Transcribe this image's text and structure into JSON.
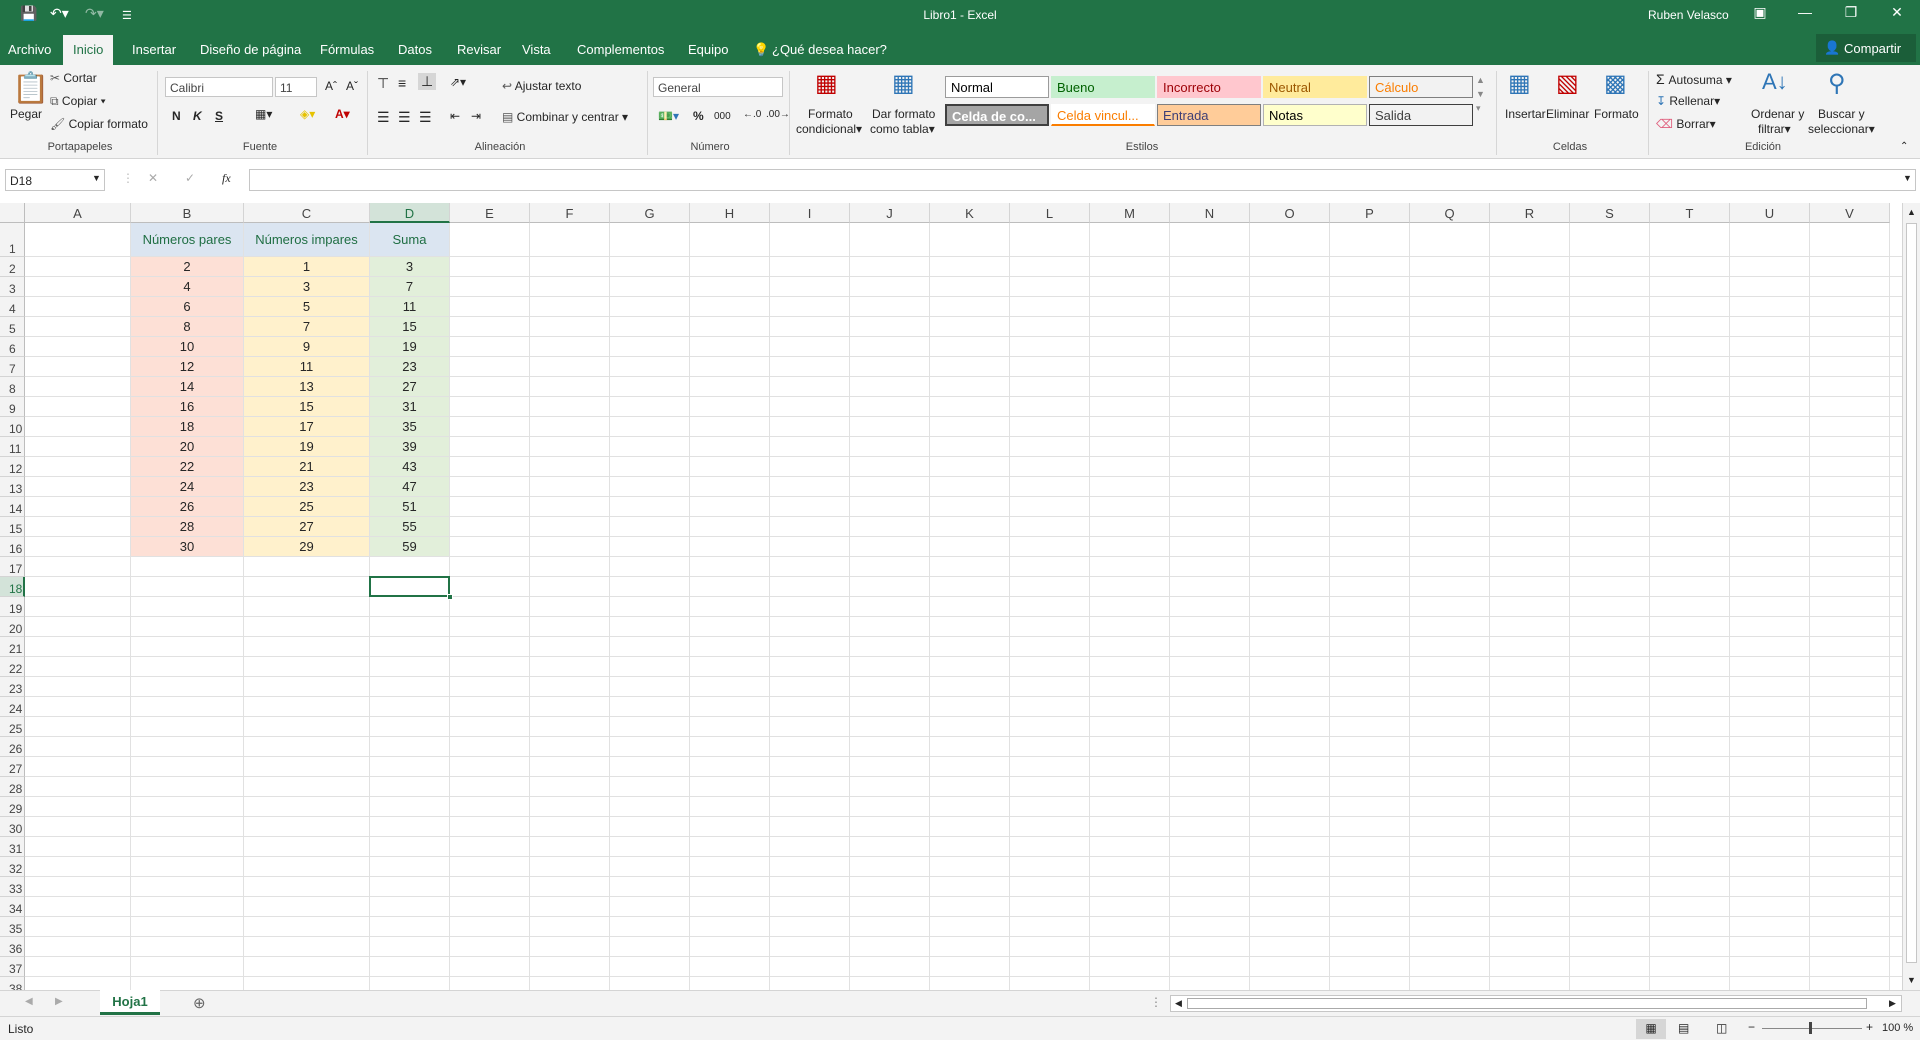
{
  "window": {
    "title": "Libro1  -  Excel",
    "user": "Ruben Velasco"
  },
  "tabs": [
    "Archivo",
    "Inicio",
    "Insertar",
    "Diseño de página",
    "Fórmulas",
    "Datos",
    "Revisar",
    "Vista",
    "Complementos",
    "Equipo"
  ],
  "tell_me": "¿Qué desea hacer?",
  "share": "Compartir",
  "ribbon": {
    "clipboard": {
      "paste": "Pegar",
      "cut": "Cortar",
      "copy": "Copiar",
      "format_painter": "Copiar formato",
      "group": "Portapapeles"
    },
    "font": {
      "name": "Calibri",
      "size": "11",
      "bold": "N",
      "italic": "K",
      "underline": "S",
      "group": "Fuente"
    },
    "alignment": {
      "wrap": "Ajustar texto",
      "merge": "Combinar y centrar",
      "group": "Alineación"
    },
    "number": {
      "format": "General",
      "percent": "%",
      "thousands": "000",
      "group": "Número"
    },
    "styles": {
      "conditional_1": "Formato",
      "conditional_2": "condicional",
      "table_1": "Dar formato",
      "table_2": "como tabla",
      "cells": [
        {
          "label": "Normal",
          "bg": "#ffffff",
          "fg": "#000000",
          "border": "#9b9b9b"
        },
        {
          "label": "Bueno",
          "bg": "#c6efce",
          "fg": "#006100",
          "border": "#c6efce"
        },
        {
          "label": "Incorrecto",
          "bg": "#ffc7ce",
          "fg": "#9c0006",
          "border": "#ffc7ce"
        },
        {
          "label": "Neutral",
          "bg": "#ffeb9c",
          "fg": "#9c5700",
          "border": "#ffeb9c"
        },
        {
          "label": "Cálculo",
          "bg": "#f2f2f2",
          "fg": "#fa7d00",
          "border": "#7f7f7f"
        },
        {
          "label": "Celda de co...",
          "bg": "#a5a5a5",
          "fg": "#ffffff",
          "border": "#3f3f3f"
        },
        {
          "label": "Celda vincul...",
          "bg": "#ffffff",
          "fg": "#fa7d00",
          "border": "#ffffff"
        },
        {
          "label": "Entrada",
          "bg": "#ffcc99",
          "fg": "#3f3f76",
          "border": "#7f7f7f"
        },
        {
          "label": "Notas",
          "bg": "#ffffcc",
          "fg": "#000000",
          "border": "#b2b2b2"
        },
        {
          "label": "Salida",
          "bg": "#f2f2f2",
          "fg": "#3f3f3f",
          "border": "#3f3f3f"
        }
      ],
      "group": "Estilos"
    },
    "cells": {
      "insert": "Insertar",
      "delete": "Eliminar",
      "format": "Formato",
      "group": "Celdas"
    },
    "editing": {
      "autosum": "Autosuma",
      "fill": "Rellenar",
      "clear": "Borrar",
      "sort_1": "Ordenar y",
      "sort_2": "filtrar",
      "find_1": "Buscar y",
      "find_2": "seleccionar",
      "group": "Edición"
    }
  },
  "formula_bar": {
    "name_box": "D18",
    "fx": "fx",
    "value": ""
  },
  "columns": [
    "A",
    "B",
    "C",
    "D",
    "E",
    "F",
    "G",
    "H",
    "I",
    "J",
    "K",
    "L",
    "M",
    "N",
    "O",
    "P",
    "Q",
    "R",
    "S",
    "T",
    "U",
    "V"
  ],
  "rows": [
    "1",
    "2",
    "3",
    "4",
    "5",
    "6",
    "7",
    "8",
    "9",
    "10",
    "11",
    "12",
    "13",
    "14",
    "15",
    "16",
    "17",
    "18",
    "19",
    "20",
    "21",
    "22",
    "23",
    "24",
    "25",
    "26",
    "27",
    "28",
    "29",
    "30",
    "31",
    "32",
    "33",
    "34",
    "35",
    "36",
    "37",
    "38"
  ],
  "selected": {
    "column": "D",
    "row": "18"
  },
  "sheet": {
    "headers": [
      "Números pares",
      "Números impares",
      "Suma"
    ],
    "header_color": "#dbe5f1",
    "header_text_color": "#1f6e43",
    "col_colors": [
      "#fde0d6",
      "#fff1cc",
      "#e2efda"
    ],
    "data": [
      [
        "2",
        "1",
        "3"
      ],
      [
        "4",
        "3",
        "7"
      ],
      [
        "6",
        "5",
        "11"
      ],
      [
        "8",
        "7",
        "15"
      ],
      [
        "10",
        "9",
        "19"
      ],
      [
        "12",
        "11",
        "23"
      ],
      [
        "14",
        "13",
        "27"
      ],
      [
        "16",
        "15",
        "31"
      ],
      [
        "18",
        "17",
        "35"
      ],
      [
        "20",
        "19",
        "39"
      ],
      [
        "22",
        "21",
        "43"
      ],
      [
        "24",
        "23",
        "47"
      ],
      [
        "26",
        "25",
        "51"
      ],
      [
        "28",
        "27",
        "55"
      ],
      [
        "30",
        "29",
        "59"
      ]
    ]
  },
  "sheet_tabs": [
    "Hoja1"
  ],
  "status": {
    "left": "Listo",
    "zoom": "100 %"
  }
}
